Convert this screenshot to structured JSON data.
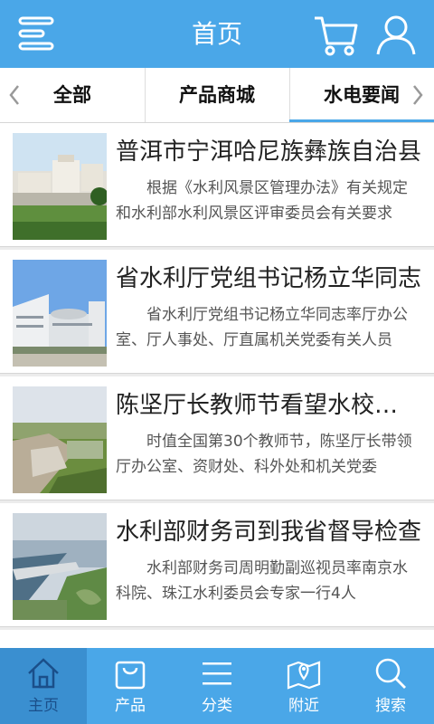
{
  "header": {
    "title": "首页",
    "icons": [
      "menu-icon",
      "cart-icon",
      "user-icon"
    ]
  },
  "tabs": [
    {
      "label": "全部"
    },
    {
      "label": "产品商城"
    },
    {
      "label": "水电要闻",
      "active": true
    }
  ],
  "news": [
    {
      "title": "普洱市宁洱哈尼族彝族自治县",
      "summary": "根据《水利风景区管理办法》有关规定和水利部水利风景区评审委员会有关要求",
      "image": "building-plaza"
    },
    {
      "title": "省水利厅党组书记杨立华同志",
      "summary": "省水利厅党组书记杨立华同志率厅办公室、厅人事处、厅直属机关党委有关人员",
      "image": "modern-building"
    },
    {
      "title": "陈坚厅长教师节看望水校教职工",
      "summary": "时值全国第30个教师节，陈坚厅长带领厅办公室、资财处、科外处和机关党委",
      "image": "construction-site"
    },
    {
      "title": "水利部财务司到我省督导检查",
      "summary": "水利部财务司周明勤副巡视员率南京水科院、珠江水利委员会专家一行4人",
      "image": "dam-aerial"
    }
  ],
  "bottom_nav": [
    {
      "label": "主页",
      "icon": "home-icon",
      "active": true
    },
    {
      "label": "产品",
      "icon": "bag-icon"
    },
    {
      "label": "分类",
      "icon": "list-icon"
    },
    {
      "label": "附近",
      "icon": "map-icon"
    },
    {
      "label": "搜索",
      "icon": "search-icon"
    }
  ],
  "colors": {
    "primary": "#4aa7e8",
    "nav_active": "#3a8fd0",
    "background": "#ececec"
  }
}
